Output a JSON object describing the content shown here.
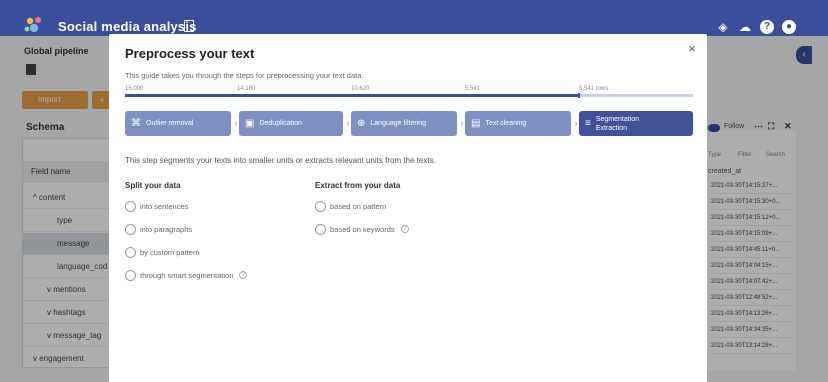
{
  "app": {
    "title": "Social media analysis",
    "pipeline_label": "Global pipeline",
    "import_label": "Import",
    "schema_title": "Schema"
  },
  "schema": {
    "header": "Field name",
    "rows": [
      {
        "label": "content",
        "prefix": "^"
      },
      {
        "label": "type",
        "prefix": ""
      },
      {
        "label": "message",
        "prefix": ""
      },
      {
        "label": "language_cod",
        "prefix": ""
      },
      {
        "label": "mentions",
        "prefix": "v"
      },
      {
        "label": "hashtags",
        "prefix": "v"
      },
      {
        "label": "message_tag",
        "prefix": "v"
      },
      {
        "label": "engagement",
        "prefix": "v"
      }
    ]
  },
  "right_panel": {
    "follow_label": "Follow",
    "sub_labels": [
      "Type",
      "Filter",
      "Search"
    ],
    "column_header": "created_at",
    "cells": [
      "2021-03-30T14:15:27+...",
      "2021-03-30T14:15:30+0...",
      "2021-03-30T14:15:12+0...",
      "2021-03-30T14:15:09+...",
      "2021-03-30T14:45:11+0...",
      "2021-03-30T14:04:15+...",
      "2021-03-30T14:07:42+...",
      "2021-03-30T12:48:52+...",
      "2021-03-30T14:13:26+...",
      "2021-03-30T14:34:35+...",
      "2021-03-30T13:14:28+..."
    ]
  },
  "modal": {
    "title": "Preprocess your text",
    "close_symbol": "×",
    "guide_text": "This guide takes you through the steps for preprocessing your text data.",
    "progress": {
      "ticks": [
        "15,000",
        "14,180",
        "10,620",
        "5,541",
        "5,541 rows"
      ],
      "fill_fraction": 0.8
    },
    "steps": [
      {
        "label": "Outlier removal",
        "icon": "⌘"
      },
      {
        "label": "Deduplication",
        "icon": "▣"
      },
      {
        "label": "Language filtering",
        "icon": "⊕"
      },
      {
        "label": "Text cleaning",
        "icon": "▤"
      },
      {
        "label_line1": "Segmentation",
        "label_line2": "Extraction",
        "icon": "≡",
        "active": true
      }
    ],
    "step_description": "This step segments your texts into smaller units or extracts relevant units from the texts.",
    "split_title": "Split your data",
    "split_options": [
      "into sentences",
      "into paragraphs",
      "by custom pattern",
      "through smart segmentation"
    ],
    "extract_title": "Extract from your data",
    "extract_options": [
      "based on pattern",
      "based on keywords"
    ]
  }
}
